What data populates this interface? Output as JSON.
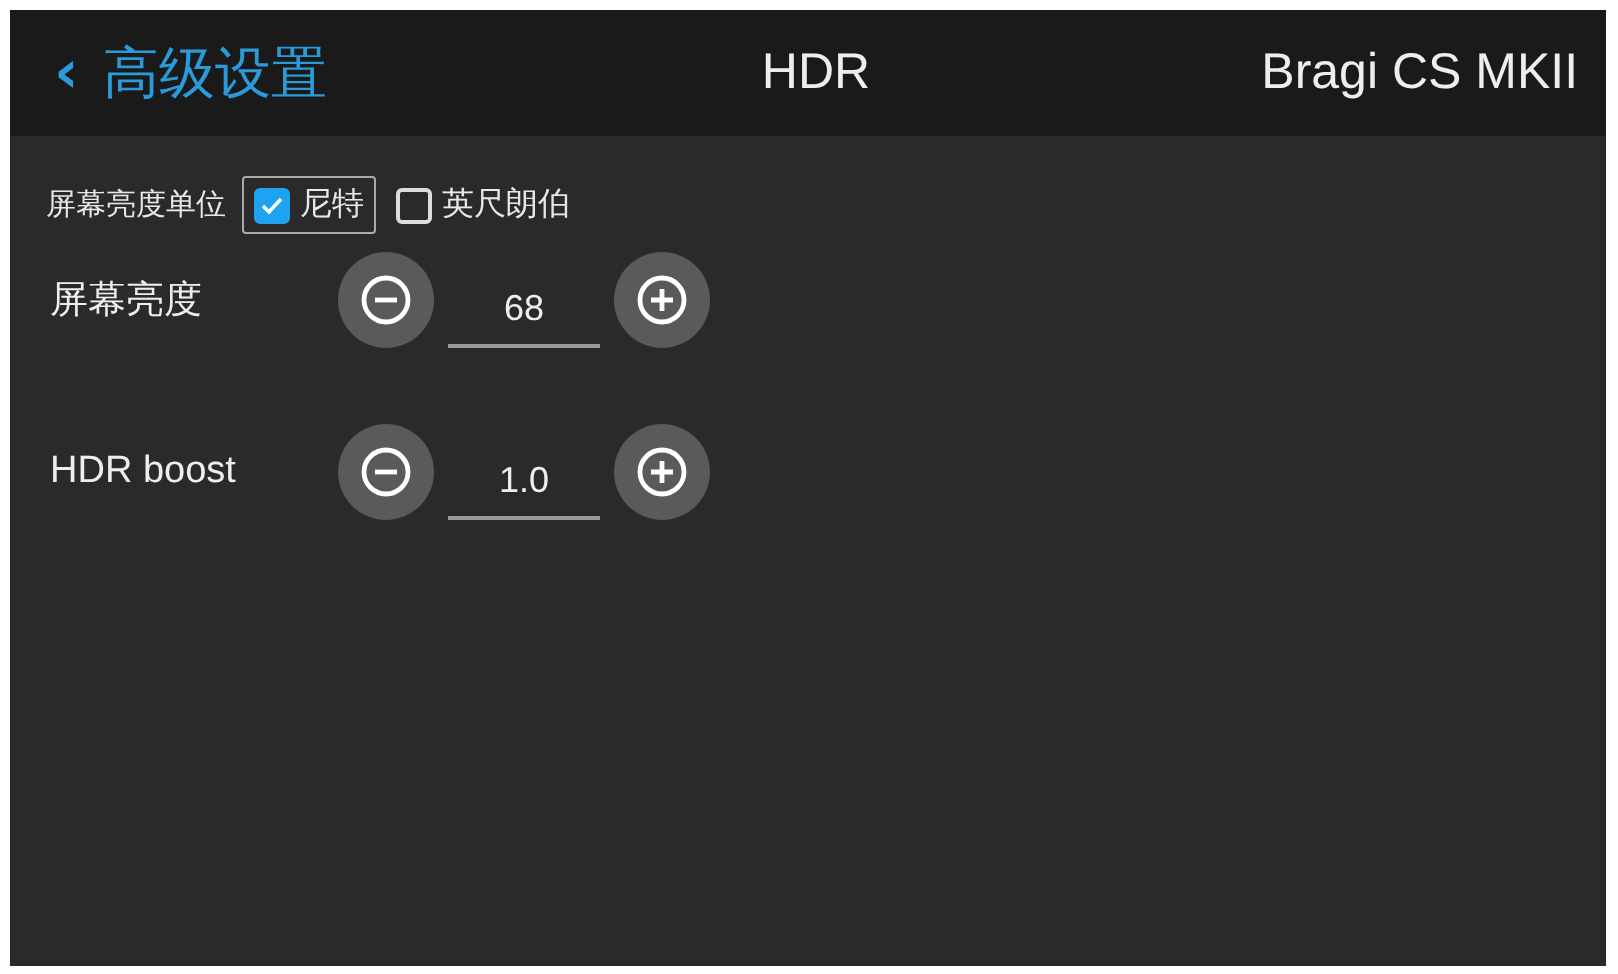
{
  "header": {
    "back_icon": "‹",
    "back_label": "高级设置",
    "title": "HDR",
    "device": "Bragi CS MKII"
  },
  "unit": {
    "label": "屏幕亮度单位",
    "options": [
      {
        "label": "尼特",
        "selected": true
      },
      {
        "label": "英尺朗伯",
        "selected": false
      }
    ]
  },
  "settings": [
    {
      "label": "屏幕亮度",
      "value": "68"
    },
    {
      "label": "HDR boost",
      "value": "1.0"
    }
  ]
}
